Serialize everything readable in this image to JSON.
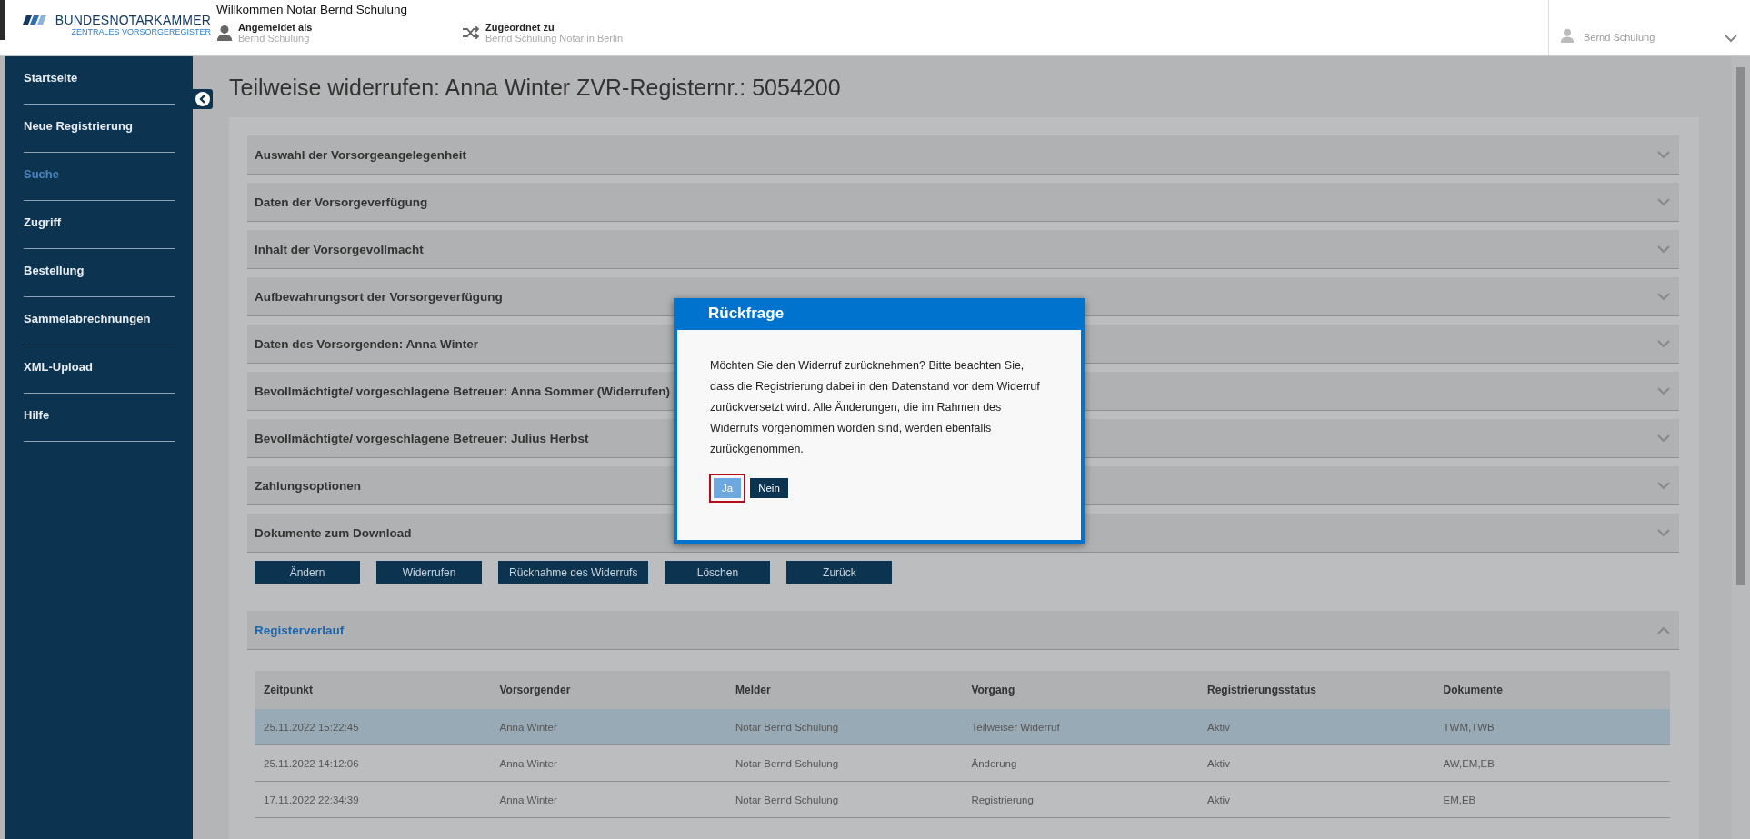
{
  "header": {
    "welcome": "Willkommen Notar Bernd Schulung",
    "logo": {
      "name": "BUNDESNOTARKAMMER",
      "subtitle": "ZENTRALES VORSORGEREGISTER"
    },
    "logged_in": {
      "label": "Angemeldet als",
      "value": "Bernd Schulung"
    },
    "assigned": {
      "label": "Zugeordnet zu",
      "value": "Bernd Schulung Notar in Berlin"
    },
    "user_menu": {
      "name": "Bernd Schulung"
    }
  },
  "sidebar": {
    "items": [
      {
        "label": "Startseite",
        "selected": false
      },
      {
        "label": "Neue Registrierung",
        "selected": false
      },
      {
        "label": "Suche",
        "selected": true
      },
      {
        "label": "Zugriff",
        "selected": false
      },
      {
        "label": "Bestellung",
        "selected": false
      },
      {
        "label": "Sammelabrechnungen",
        "selected": false
      },
      {
        "label": "XML-Upload",
        "selected": false
      },
      {
        "label": "Hilfe",
        "selected": false
      }
    ]
  },
  "title": "Teilweise widerrufen: Anna Winter ZVR-Registernr.: 5054200",
  "sections": [
    {
      "label": "Auswahl der Vorsorgeangelegenheit",
      "expanded": false
    },
    {
      "label": "Daten der Vorsorgeverfügung",
      "expanded": false
    },
    {
      "label": "Inhalt der Vorsorgevollmacht",
      "expanded": false
    },
    {
      "label": "Aufbewahrungsort der Vorsorgeverfügung",
      "expanded": false
    },
    {
      "label": "Daten des Vorsorgenden: Anna Winter",
      "expanded": false
    },
    {
      "label": "Bevollmächtigte/ vorgeschlagene Betreuer: Anna Sommer (Widerrufen)",
      "expanded": false
    },
    {
      "label": "Bevollmächtigte/ vorgeschlagene Betreuer: Julius Herbst",
      "expanded": false
    },
    {
      "label": "Zahlungsoptionen",
      "expanded": false
    },
    {
      "label": "Dokumente zum Download",
      "expanded": false
    }
  ],
  "actions": [
    "Ändern",
    "Widerrufen",
    "Rücknahme des Widerrufs",
    "Löschen",
    "Zurück"
  ],
  "history": {
    "title": "Registerverlauf",
    "expanded": true,
    "columns": [
      "Zeitpunkt",
      "Vorsorgender",
      "Melder",
      "Vorgang",
      "Registrierungsstatus",
      "Dokumente"
    ],
    "rows": [
      {
        "selected": true,
        "cells": [
          "25.11.2022 15:22:45",
          "Anna Winter",
          "Notar Bernd Schulung",
          "Teilweiser Widerruf",
          "Aktiv",
          "TWM,TWB"
        ]
      },
      {
        "selected": false,
        "cells": [
          "25.11.2022 14:12:06",
          "Anna Winter",
          "Notar Bernd Schulung",
          "Änderung",
          "Aktiv",
          "AW,EM,EB"
        ]
      },
      {
        "selected": false,
        "cells": [
          "17.11.2022 22:34:39",
          "Anna Winter",
          "Notar Bernd Schulung",
          "Registrierung",
          "Aktiv",
          "EM,EB"
        ]
      }
    ]
  },
  "dialog": {
    "title": "Rückfrage",
    "message": "Möchten Sie den Widerruf zurücknehmen? Bitte beachten Sie, dass die Registrierung dabei in den Datenstand vor dem Widerruf zurückversetzt wird. Alle Änderungen, die im Rahmen des Widerrufs vorgenommen worden sind, werden ebenfalls zurückgenommen.",
    "buttons": [
      {
        "label": "Ja",
        "focused": true
      },
      {
        "label": "Nein",
        "focused": false
      }
    ]
  }
}
